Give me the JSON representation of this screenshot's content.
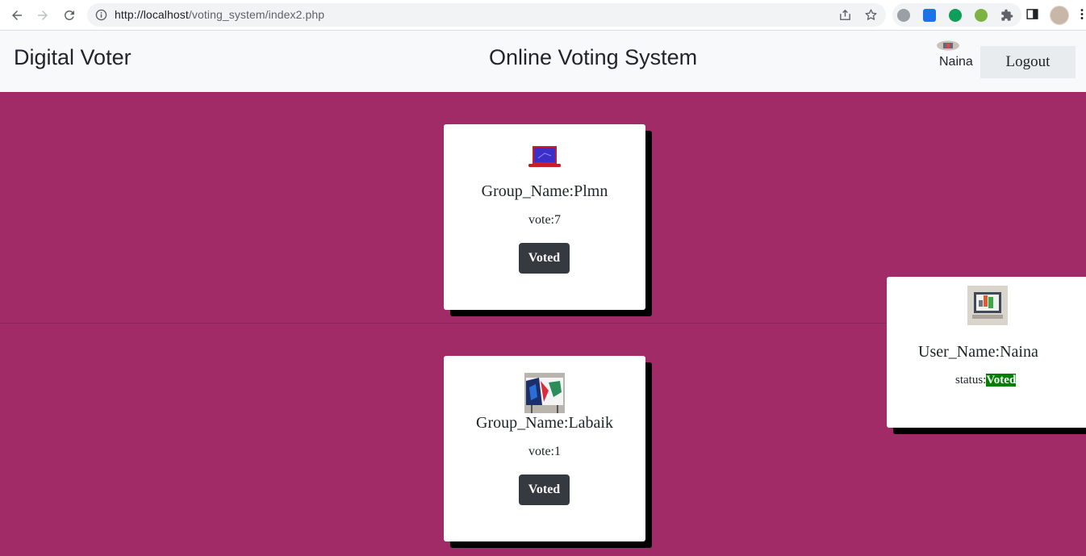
{
  "browser": {
    "url_host": "http://localhost",
    "url_path": "/voting_system/index2.php"
  },
  "header": {
    "brand": "Digital Voter",
    "title": "Online Voting System",
    "user_name": "Naina",
    "logout_label": "Logout"
  },
  "groups": [
    {
      "name_label": "Group_Name:",
      "name": "Plmn",
      "vote_label": "vote:",
      "votes": "7",
      "button_label": "Voted"
    },
    {
      "name_label": "Group_Name:",
      "name": "Labaik",
      "vote_label": "vote:",
      "votes": "1",
      "button_label": "Voted"
    }
  ],
  "user_card": {
    "name_label": "User_Name:",
    "name": "Naina",
    "status_label": "status:",
    "status": "Voted"
  },
  "colors": {
    "page_bg": "#a02b66",
    "header_bg": "#f8f9fa",
    "button_bg": "#343a40",
    "status_bg": "#008000"
  }
}
